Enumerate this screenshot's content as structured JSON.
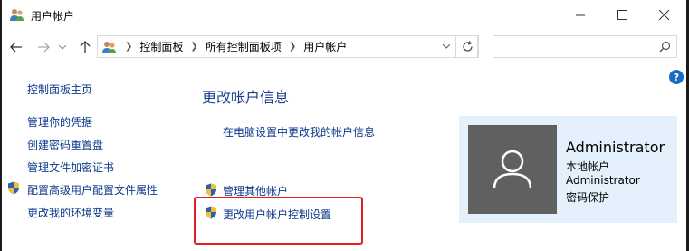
{
  "window": {
    "title": "用户帐户",
    "controls": [
      "minimize",
      "maximize",
      "close"
    ]
  },
  "nav": {
    "breadcrumb": [
      "控制面板",
      "所有控制面板项",
      "用户帐户"
    ],
    "search_value": "",
    "icons": [
      "back-arrow-icon",
      "forward-arrow-icon",
      "dropdown-icon",
      "up-arrow-icon",
      "refresh-icon",
      "search-icon"
    ]
  },
  "sidebar": {
    "home": "控制面板主页",
    "items": [
      {
        "label": "管理你的凭据",
        "shield": false
      },
      {
        "label": "创建密码重置盘",
        "shield": false
      },
      {
        "label": "管理文件加密证书",
        "shield": false
      },
      {
        "label": "配置高级用户配置文件属性",
        "shield": true
      },
      {
        "label": "更改我的环境变量",
        "shield": false
      }
    ]
  },
  "main": {
    "title": "更改帐户信息",
    "links": [
      {
        "label": "在电脑设置中更改我的帐户信息",
        "shield": false
      },
      {
        "label": "管理其他帐户",
        "shield": true
      },
      {
        "label": "更改用户帐户控制设置",
        "shield": true
      }
    ]
  },
  "account": {
    "name": "Administrator",
    "type": "本地帐户",
    "group": "Administrator",
    "password": "密码保护"
  },
  "colors": {
    "link": "#0c3a8c",
    "title": "#1a3f8c",
    "highlight": "#e0201e",
    "card_bg": "#e4f0fb",
    "avatar_bg": "#606060"
  }
}
